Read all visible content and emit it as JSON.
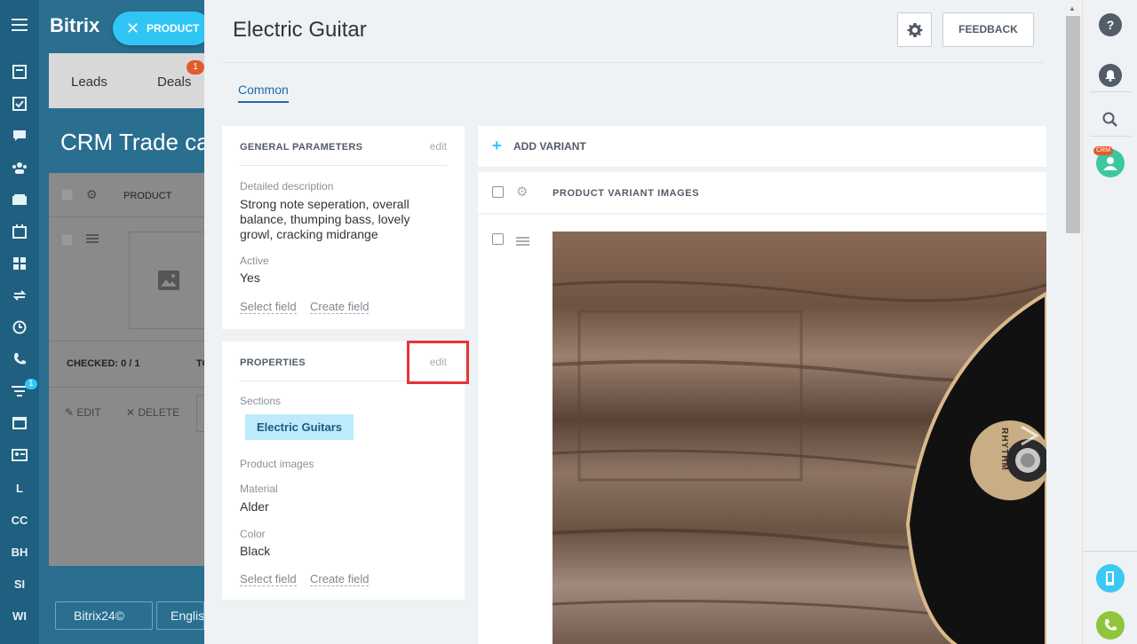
{
  "background": {
    "logo": "Bitrix",
    "tabs": [
      "Leads",
      "Deals"
    ],
    "deals_badge": "1",
    "page_title": "CRM Trade catalog",
    "grid_header": "PRODUCT",
    "checked": "CHECKED: 0 / 1",
    "total_stub": "TO",
    "edit_action": "EDIT",
    "delete_action": "DELETE",
    "footer_logo": "Bitrix24©",
    "footer_lang": "English"
  },
  "leftnav": {
    "items": [
      "menu-icon",
      "feed-icon",
      "tasks-icon",
      "chat-icon",
      "contacts-icon",
      "crm-icon",
      "calendar-icon",
      "apps-icon",
      "sync-icon",
      "time-icon",
      "phone-icon",
      "filter-icon",
      "window-icon",
      "id-card-icon"
    ],
    "text_items": [
      "L",
      "CC",
      "BH",
      "SI",
      "WI"
    ],
    "filter_badge": "1"
  },
  "product_pill": {
    "label": "PRODUCT"
  },
  "slider": {
    "title": "Electric Guitar",
    "feedback_label": "FEEDBACK",
    "tab_common": "Common"
  },
  "general": {
    "header": "GENERAL PARAMETERS",
    "edit": "edit",
    "desc_label": "Detailed description",
    "desc_value": "Strong note seperation, overall balance, thumping bass, lovely growl, cracking midrange",
    "active_label": "Active",
    "active_value": "Yes",
    "select_field": "Select field",
    "create_field": "Create field"
  },
  "properties": {
    "header": "PROPERTIES",
    "edit": "edit",
    "sections_label": "Sections",
    "section_tag": "Electric Guitars",
    "images_label": "Product images",
    "material_label": "Material",
    "material_value": "Alder",
    "color_label": "Color",
    "color_value": "Black",
    "select_field": "Select field",
    "create_field": "Create field"
  },
  "variants": {
    "add_label": "ADD VARIANT",
    "header": "PRODUCT VARIANT IMAGES",
    "photo_caption": "RHYTHM"
  },
  "rightbar": {
    "crm_badge": "CRM",
    "icons": [
      "help-icon",
      "bell-icon",
      "search-icon",
      "user-avatar",
      "mobile-icon",
      "call-icon"
    ]
  }
}
